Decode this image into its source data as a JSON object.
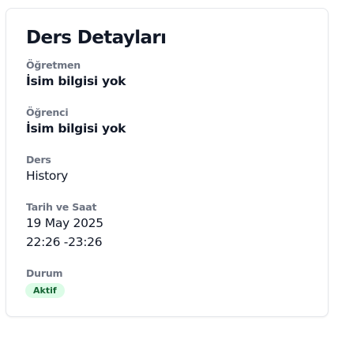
{
  "card": {
    "title": "Ders Detayları",
    "teacher": {
      "label": "Öğretmen",
      "value": "İsim bilgisi yok"
    },
    "student": {
      "label": "Öğrenci",
      "value": "İsim bilgisi yok"
    },
    "course": {
      "label": "Ders",
      "value": "History"
    },
    "datetime": {
      "label": "Tarih ve Saat",
      "date": "19 May 2025",
      "time": "22:26 -23:26"
    },
    "status": {
      "label": "Durum",
      "value": "Aktif",
      "color": "#166534",
      "background": "#dcfce7"
    }
  }
}
